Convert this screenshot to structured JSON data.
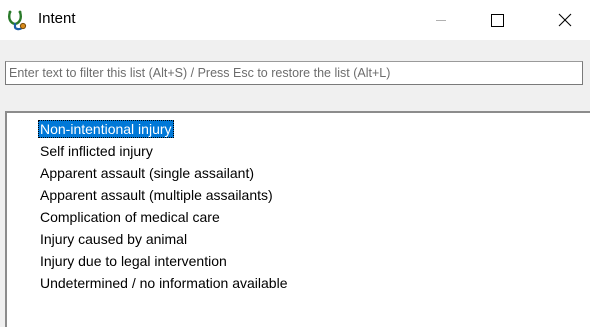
{
  "window": {
    "title": "Intent",
    "app_icon": "stethoscope-icon",
    "controls": [
      "minimize-icon",
      "maximize-icon",
      "close-icon"
    ]
  },
  "filter": {
    "placeholder": "Enter text to filter this list (Alt+S) / Press Esc to restore the list (Alt+L)",
    "value": ""
  },
  "list": {
    "selected_index": 0,
    "items": [
      {
        "label": "Non-intentional injury"
      },
      {
        "label": "Self inflicted injury"
      },
      {
        "label": "Apparent assault (single assailant)"
      },
      {
        "label": "Apparent assault (multiple assailants)"
      },
      {
        "label": "Complication of medical care"
      },
      {
        "label": "Injury caused by animal"
      },
      {
        "label": "Injury due to legal intervention"
      },
      {
        "label": "Undetermined / no information available"
      }
    ]
  },
  "colors": {
    "selection": "#0078d7",
    "window_background": "#f0f0f0",
    "titlebar": "#ffffff"
  }
}
